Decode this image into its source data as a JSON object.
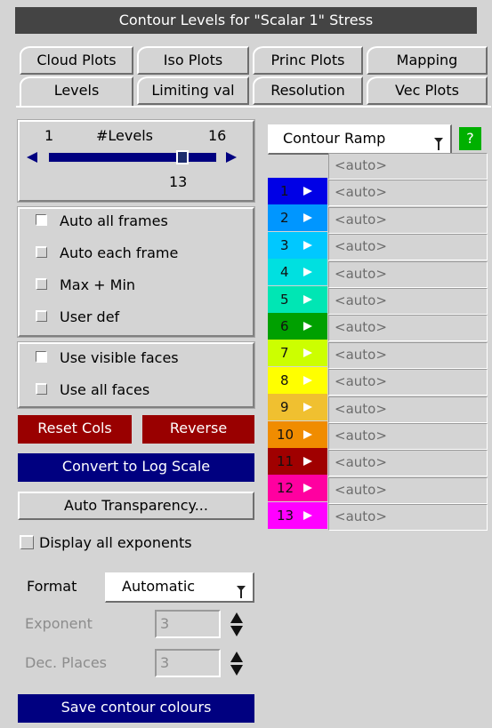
{
  "window": {
    "title": "Contour Levels for \"Scalar 1\" Stress"
  },
  "tabs": {
    "row1": [
      "Cloud Plots",
      "Iso Plots",
      "Princ Plots",
      "Mapping"
    ],
    "row2": [
      "Levels",
      "Limiting val",
      "Resolution",
      "Vec Plots"
    ],
    "active": "Levels"
  },
  "levels_slider": {
    "min_label": "1",
    "title": "#Levels",
    "max_label": "16",
    "value": "13",
    "fraction": 0.8
  },
  "frame_mode": {
    "options": [
      "Auto all frames",
      "Auto each frame",
      "Max + Min",
      "User def"
    ],
    "selected": "Auto all frames"
  },
  "face_mode": {
    "options": [
      "Use visible faces",
      "Use all faces"
    ],
    "selected": "Use visible faces"
  },
  "buttons": {
    "reset_cols": "Reset Cols",
    "reverse": "Reverse",
    "convert_log": "Convert to Log Scale",
    "auto_transparency": "Auto Transparency...",
    "save_colours": "Save contour colours"
  },
  "display_exponents": {
    "label": "Display all exponents",
    "checked": false
  },
  "format": {
    "label": "Format",
    "value": "Automatic"
  },
  "exponent": {
    "label": "Exponent",
    "value": "3"
  },
  "dec_places": {
    "label": "Dec. Places",
    "value": "3"
  },
  "ramp": {
    "label": "Contour Ramp",
    "help": "?"
  },
  "ramp_levels": [
    {
      "num": "1",
      "color": "#0000e6",
      "value": "<auto>"
    },
    {
      "num": "2",
      "color": "#0096ff",
      "value": "<auto>"
    },
    {
      "num": "3",
      "color": "#00c8ff",
      "value": "<auto>"
    },
    {
      "num": "4",
      "color": "#00e0e0",
      "value": "<auto>"
    },
    {
      "num": "5",
      "color": "#00e6b4",
      "value": "<auto>"
    },
    {
      "num": "6",
      "color": "#00a000",
      "value": "<auto>"
    },
    {
      "num": "7",
      "color": "#ccff00",
      "value": "<auto>"
    },
    {
      "num": "8",
      "color": "#ffff00",
      "value": "<auto>"
    },
    {
      "num": "9",
      "color": "#f0c030",
      "value": "<auto>"
    },
    {
      "num": "10",
      "color": "#f08c00",
      "value": "<auto>"
    },
    {
      "num": "11",
      "color": "#a00000",
      "value": "<auto>"
    },
    {
      "num": "12",
      "color": "#ff00a0",
      "value": "<auto>"
    },
    {
      "num": "13",
      "color": "#ff00ff",
      "value": "<auto>"
    }
  ],
  "extra_auto": "<auto>",
  "colors": {
    "panel_bg": "#d4d4d4",
    "title_bg": "#444444",
    "button_red": "#990000",
    "button_blue": "#000080",
    "help_green": "#00b000"
  }
}
